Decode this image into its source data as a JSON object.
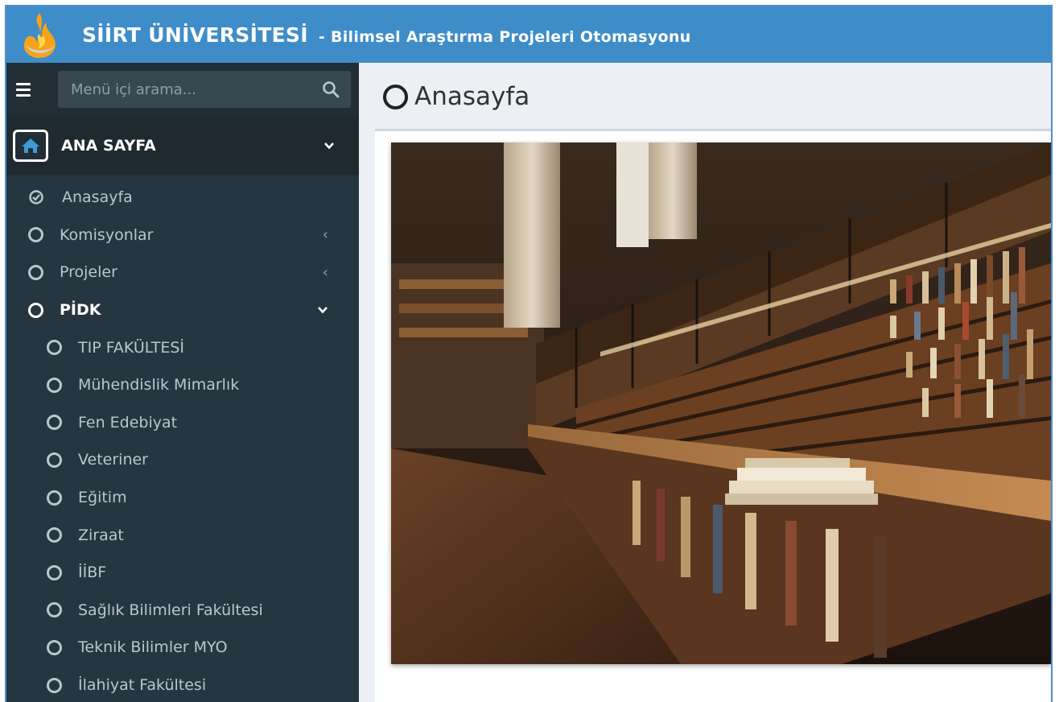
{
  "header": {
    "brand": "SİİRT ÜNİVERSİTESİ",
    "subtitle": "- Bilimsel Araştırma Projeleri Otomasyonu"
  },
  "sidebar": {
    "search_placeholder": "Menü içi arama...",
    "section_title": "ANA SAYFA",
    "items": [
      {
        "label": "Anasayfa",
        "icon": "check-circle-icon"
      },
      {
        "label": "Komisyonlar",
        "icon": "circle-icon",
        "arrow": "‹"
      },
      {
        "label": "Projeler",
        "icon": "circle-icon",
        "arrow": "‹"
      },
      {
        "label": "PİDK",
        "icon": "circle-icon",
        "expanded": true
      }
    ],
    "subitems": [
      {
        "label": "TIP FAKÜLTESİ"
      },
      {
        "label": "Mühendislik Mimarlık"
      },
      {
        "label": "Fen Edebiyat"
      },
      {
        "label": "Veteriner"
      },
      {
        "label": "Eğitim"
      },
      {
        "label": "Ziraat"
      },
      {
        "label": "İİBF"
      },
      {
        "label": "Sağlık Bilimleri Fakültesi"
      },
      {
        "label": "Teknik Bilimler MYO"
      },
      {
        "label": "İlahiyat Fakültesi"
      }
    ]
  },
  "main": {
    "page_title": "Anasayfa"
  },
  "colors": {
    "header": "#3f8dc8",
    "sidebar": "#263640",
    "sidebar_dark": "#1e2a30",
    "sidebar_text": "#b8c7ce",
    "content_bg": "#ecf0f5"
  }
}
